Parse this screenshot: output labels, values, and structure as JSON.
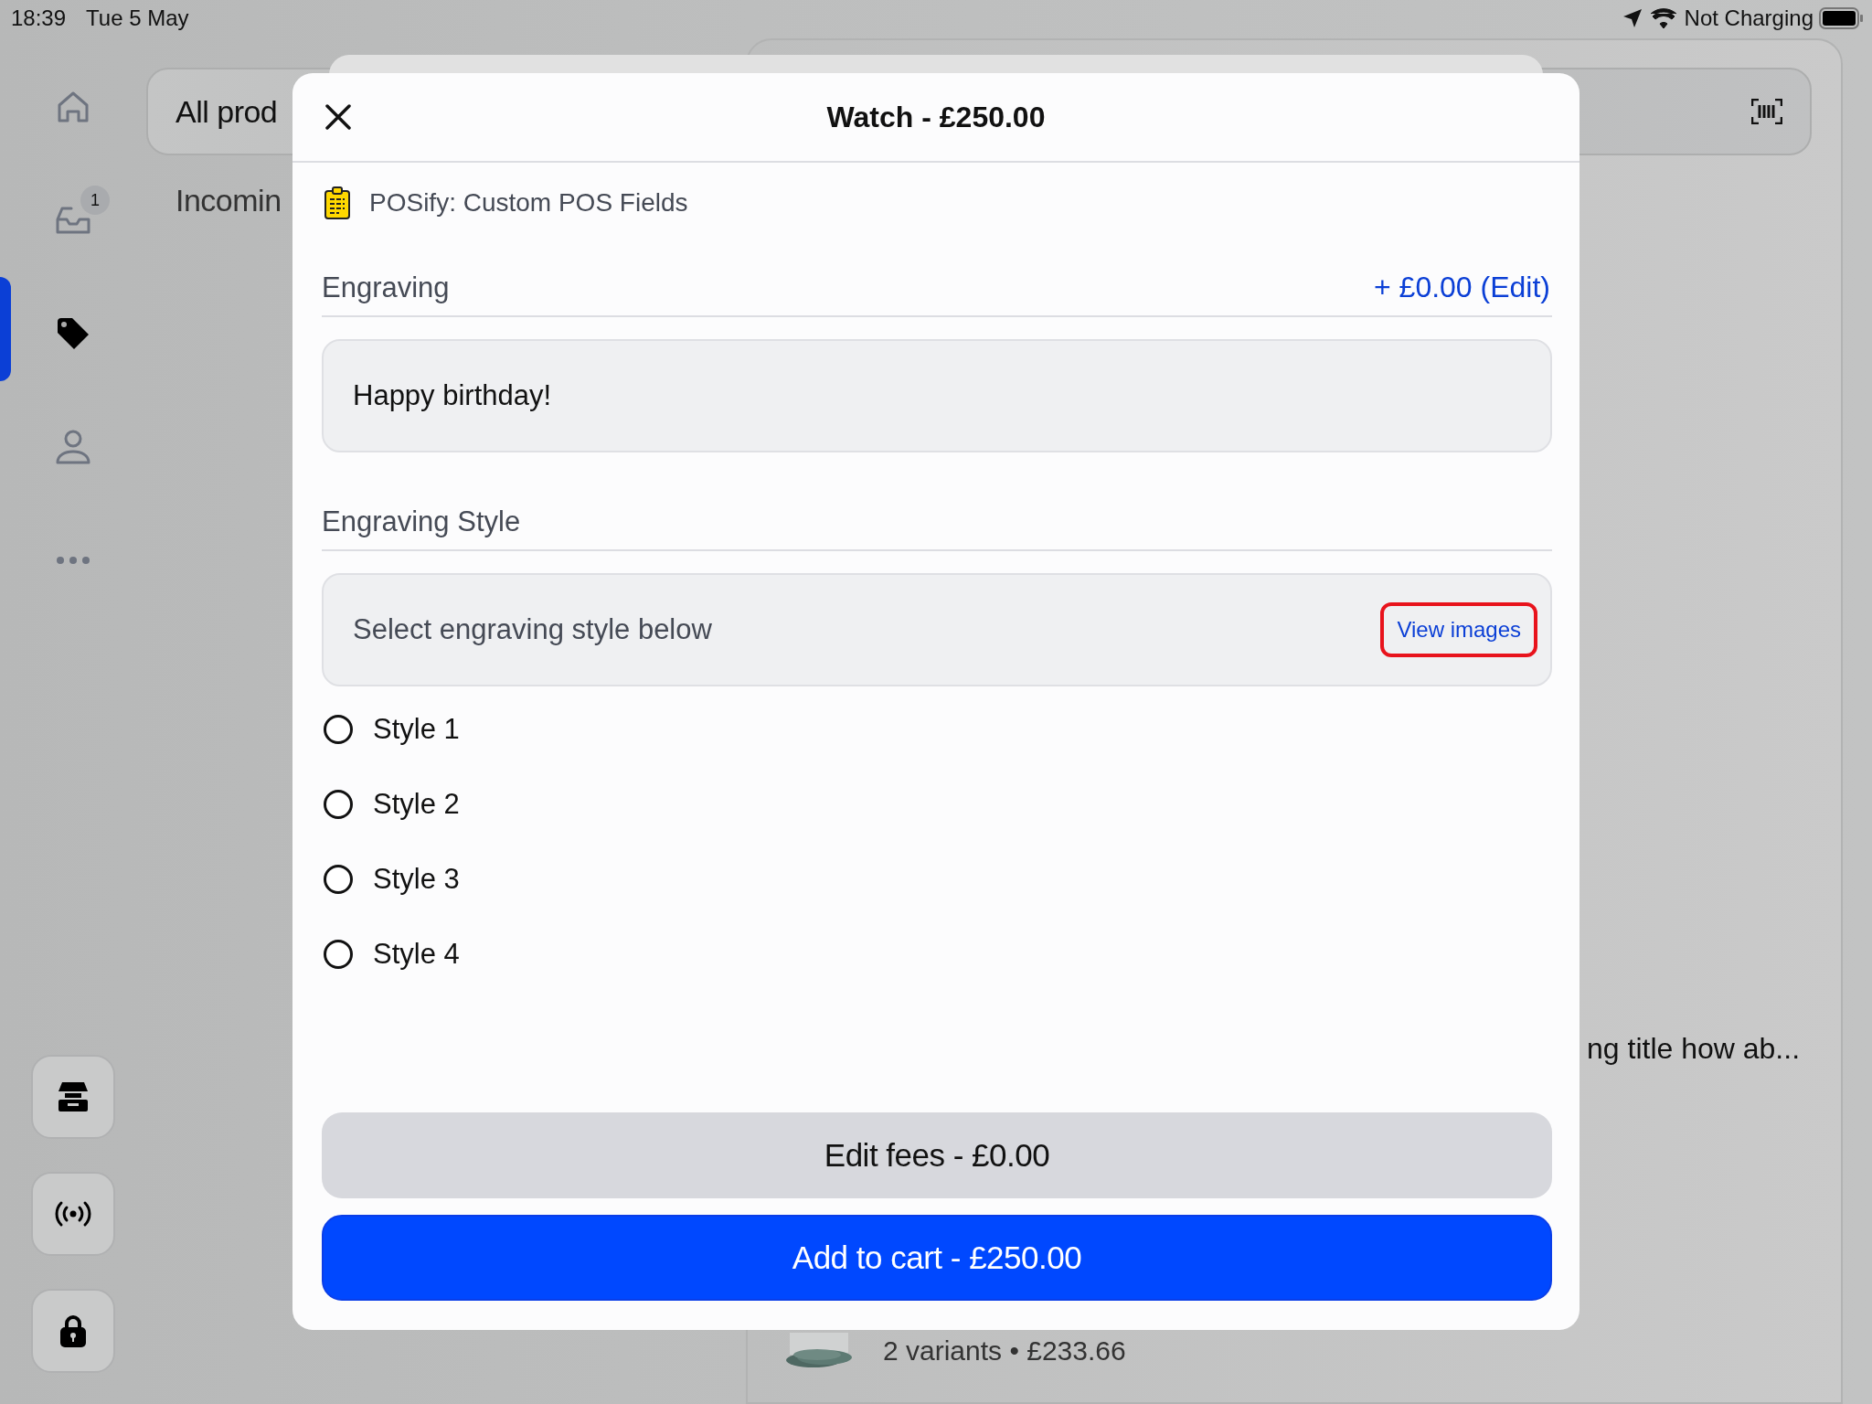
{
  "status_bar": {
    "time": "18:39",
    "date": "Tue 5 May",
    "battery_text": "Not Charging"
  },
  "sidebar": {
    "items": [
      {
        "selected": false
      },
      {
        "selected": false,
        "badge": "1"
      },
      {
        "selected": true
      },
      {
        "selected": false
      },
      {
        "selected": false
      }
    ]
  },
  "background": {
    "search_text": "All prod",
    "section_title": "Incomin",
    "product_title": "ng title how ab...",
    "product_meta": "2 variants • £233.66"
  },
  "modal": {
    "title": "Watch - £250.00",
    "app_name": "POSify: Custom POS Fields",
    "fields": [
      {
        "kind": "text",
        "label": "Engraving",
        "price": "+ £0.00 (Edit)",
        "value": "Happy birthday!"
      },
      {
        "kind": "radio",
        "label": "Engraving Style",
        "hint": "Select engraving style below",
        "link": "View images",
        "options": [
          {
            "label": "Style 1",
            "selected": false
          },
          {
            "label": "Style 2",
            "selected": false
          },
          {
            "label": "Style 3",
            "selected": false
          },
          {
            "label": "Style 4",
            "selected": false
          }
        ]
      }
    ],
    "buttons": [
      {
        "kind": "secondary",
        "label": "Edit fees - £0.00"
      },
      {
        "kind": "primary",
        "label": "Add to cart - £250.00"
      }
    ]
  }
}
